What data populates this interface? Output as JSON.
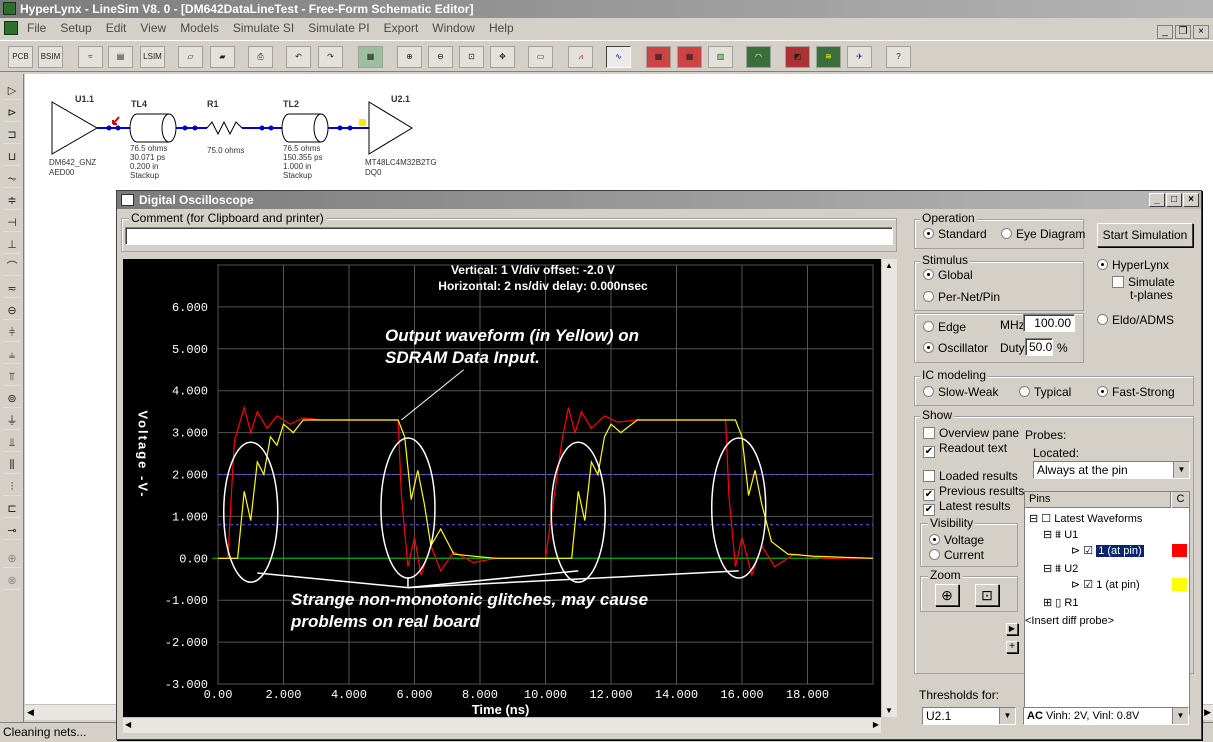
{
  "app": {
    "title": "HyperLynx - LineSim V8. 0 - [DM642DataLineTest - Free-Form Schematic Editor]",
    "menu": [
      "File",
      "Setup",
      "Edit",
      "View",
      "Models",
      "Simulate SI",
      "Simulate PI",
      "Export",
      "Window",
      "Help"
    ],
    "status": "Cleaning nets..."
  },
  "toolbar": {
    "pcb": "PCB",
    "bsim": "BSIM",
    "lsim": "LSIM"
  },
  "schematic": {
    "u11": {
      "ref": "U1.1",
      "model": "DM642_GNZ",
      "pin": "AED00"
    },
    "tl4": {
      "ref": "TL4",
      "l1": "76.5 ohms",
      "l2": "30.071 ps",
      "l3": "0.200 in",
      "l4": "Stackup"
    },
    "r1": {
      "ref": "R1",
      "value": "75.0 ohms"
    },
    "tl2": {
      "ref": "TL2",
      "l1": "76.5 ohms",
      "l2": "150.355 ps",
      "l3": "1.000 in",
      "l4": "Stackup"
    },
    "u21": {
      "ref": "U2.1",
      "model": "MT48LC4M32B2TG",
      "pin": "DQ0"
    }
  },
  "scope": {
    "title": "Digital Oscilloscope",
    "comment_label": "Comment (for Clipboard and printer)",
    "comment_value": "",
    "readout_vertical": "Vertical: 1  V/div  offset: -2.0 V",
    "readout_horizontal": "Horizontal: 2 ns/div  delay: 0.000nsec",
    "annotation_output": "Output waveform (in Yellow) on",
    "annotation_output2": "SDRAM Data Input.",
    "annotation_glitch": "Strange non-monotonic glitches, may cause",
    "annotation_glitch2": "problems on real board",
    "operation": {
      "label": "Operation",
      "standard": "Standard",
      "eye": "Eye Diagram",
      "selected": "Standard"
    },
    "start_button": "Start Simulation",
    "engine": {
      "hyperlynx": "HyperLynx",
      "simulate_tplanes": "Simulate",
      "simulate_tplanes2": "t-planes",
      "eldo": "Eldo/ADMS"
    },
    "stimulus": {
      "label": "Stimulus",
      "global": "Global",
      "per_net": "Per-Net/Pin"
    },
    "edge": {
      "edge": "Edge",
      "oscillator": "Oscillator",
      "mhz_label": "MHz",
      "mhz_value": "100.00",
      "duty_label": "Duty",
      "duty_value": "50.0",
      "duty_unit": "%"
    },
    "ic": {
      "label": "IC modeling",
      "slow": "Slow-Weak",
      "typical": "Typical",
      "fast": "Fast-Strong"
    },
    "show": {
      "label": "Show",
      "overview": "Overview pane",
      "readout": "Readout text",
      "loaded": "Loaded results",
      "previous": "Previous results",
      "latest": "Latest results"
    },
    "probes": {
      "label": "Probes:",
      "located_label": "Located:",
      "located_value": "Always at the pin"
    },
    "visibility": {
      "label": "Visibility",
      "voltage": "Voltage",
      "current": "Current"
    },
    "zoom": {
      "label": "Zoom"
    },
    "pins_header": "Pins",
    "pins_header_c": "C",
    "tree": {
      "root": "Latest Waveforms",
      "u1": "U1",
      "u1pin": "1 (at pin)",
      "u1_color": "#ff0000",
      "u2": "U2",
      "u2pin": "1 (at pin)",
      "u2_color": "#ffff00",
      "r1": "R1",
      "insert": "<Insert diff probe>"
    },
    "thresholds_label": "Thresholds for:",
    "thresholds_value": "U2.1",
    "threshold_spec": "Vinh: 2V, Vinl: 0.8V",
    "threshold_ac": "AC"
  },
  "chart_data": {
    "type": "line",
    "xlabel": "Time  (ns)",
    "ylabel": "Voltage -V-",
    "xlim": [
      0,
      20
    ],
    "ylim": [
      -3,
      7
    ],
    "x_ticks": [
      "0.00",
      "2.000",
      "4.000",
      "6.000",
      "8.000",
      "10.000",
      "12.000",
      "14.000",
      "16.000",
      "18.000"
    ],
    "y_ticks": [
      "6.000",
      "5.000",
      "4.000",
      "3.000",
      "2.000",
      "1.000",
      "0.00",
      "-1.000",
      "-2.000",
      "-3.000"
    ],
    "thresholds": [
      2.0,
      0.8
    ],
    "series": [
      {
        "name": "U1 1 (at pin)",
        "color": "#ff0000",
        "x": [
          0,
          0.3,
          0.5,
          0.8,
          1.0,
          1.2,
          1.5,
          1.8,
          2.2,
          2.6,
          3.2,
          5.5,
          5.6,
          5.8,
          6.0,
          6.2,
          6.5,
          6.8,
          7.2,
          7.8,
          8.5,
          10.0,
          10.5,
          10.7,
          10.9,
          11.1,
          11.4,
          11.8,
          12.2,
          12.8,
          15.5,
          15.6,
          15.8,
          16.0,
          16.3,
          16.6,
          17.0,
          17.6,
          18.5,
          20.0
        ],
        "y": [
          0,
          0,
          2.8,
          3.6,
          3.0,
          3.5,
          3.1,
          3.4,
          3.2,
          3.35,
          3.3,
          3.3,
          1.5,
          -0.2,
          0.5,
          -0.4,
          0.3,
          -0.3,
          0.15,
          -0.1,
          0,
          0,
          2.8,
          3.6,
          3.0,
          3.5,
          3.1,
          3.4,
          3.25,
          3.3,
          3.3,
          1.5,
          -0.2,
          0.5,
          -0.4,
          0.3,
          -0.2,
          0.1,
          0,
          0
        ]
      },
      {
        "name": "U2 1 (at pin)",
        "color": "#ffff00",
        "x": [
          0,
          0.6,
          0.8,
          1.0,
          1.2,
          1.4,
          1.6,
          1.8,
          2.0,
          2.3,
          2.6,
          3.0,
          5.5,
          5.7,
          5.9,
          6.1,
          6.3,
          6.5,
          6.8,
          7.2,
          7.8,
          8.5,
          10.0,
          10.8,
          11.0,
          11.2,
          11.4,
          11.6,
          11.8,
          12.0,
          12.3,
          12.8,
          15.8,
          16.0,
          16.2,
          16.4,
          16.6,
          16.9,
          17.4,
          18.2,
          20.0
        ],
        "y": [
          0,
          0,
          1.6,
          0.9,
          2.3,
          2.0,
          2.9,
          2.7,
          3.2,
          3.0,
          3.3,
          3.3,
          3.3,
          2.9,
          1.4,
          2.1,
          1.3,
          0.3,
          0.7,
          0.1,
          0.05,
          0,
          0,
          0,
          1.6,
          0.9,
          2.3,
          2.0,
          2.9,
          3.2,
          3.0,
          3.3,
          3.3,
          2.9,
          1.5,
          2.1,
          1.3,
          0.4,
          0.1,
          0.05,
          0
        ]
      }
    ]
  }
}
